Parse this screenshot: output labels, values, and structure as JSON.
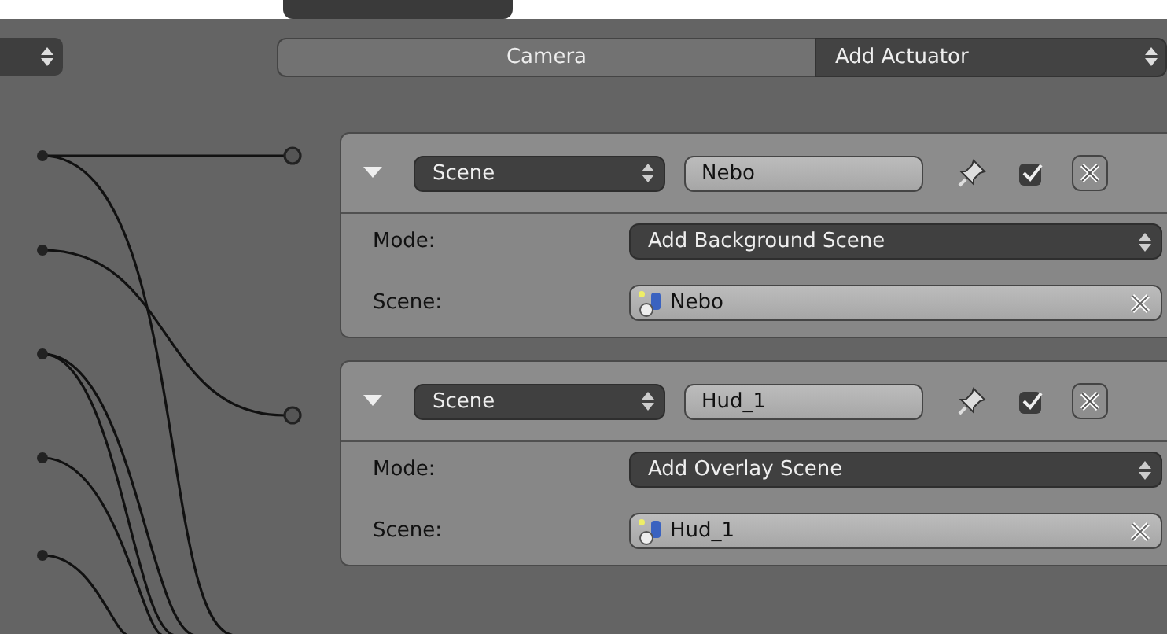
{
  "object_field": {
    "value": "Camera"
  },
  "add_actuator": {
    "label": "Add Actuator"
  },
  "actuators": [
    {
      "expanded": true,
      "type": "Scene",
      "name": "Nebo",
      "active": true,
      "mode_label": "Mode:",
      "mode": "Add Background Scene",
      "scene_label": "Scene:",
      "scene": "Nebo"
    },
    {
      "expanded": true,
      "type": "Scene",
      "name": "Hud_1",
      "active": true,
      "mode_label": "Mode:",
      "mode": "Add Overlay Scene",
      "scene_label": "Scene:",
      "scene": "Hud_1"
    }
  ]
}
